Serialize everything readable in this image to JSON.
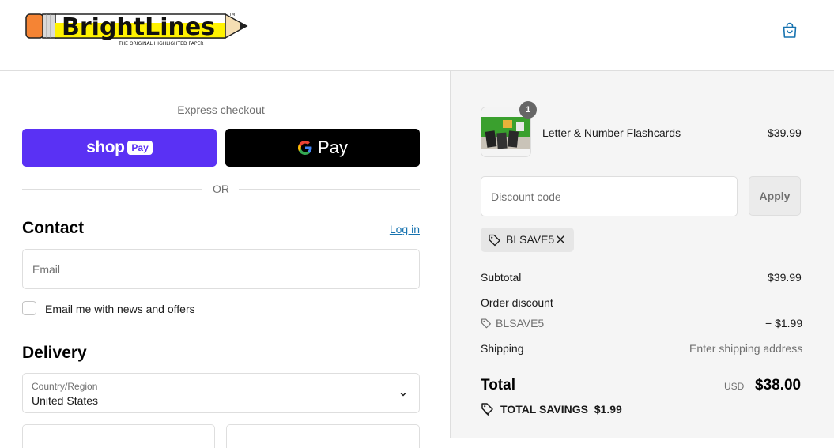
{
  "brand": {
    "logo_text": "BrightLines",
    "tagline": "THE ORIGINAL HIGHLIGHTED PAPER",
    "tm": "TM",
    "accent_color": "#1773b0"
  },
  "header": {
    "cart_icon": "shopping-bag-icon"
  },
  "express": {
    "title": "Express checkout",
    "shop_pay_word": "shop",
    "shop_pay_badge": "Pay",
    "shop_pay_color": "#5a31f4",
    "gpay_word": "Pay",
    "or_text": "OR"
  },
  "contact": {
    "title": "Contact",
    "login_link": "Log in",
    "email_placeholder": "Email",
    "newsletter_label": "Email me with news and offers",
    "newsletter_checked": false
  },
  "delivery": {
    "title": "Delivery",
    "country_label": "Country/Region",
    "country_value": "United States"
  },
  "summary": {
    "item": {
      "quantity": "1",
      "name": "Letter & Number Flashcards",
      "price": "$39.99"
    },
    "discount_placeholder": "Discount code",
    "apply_label": "Apply",
    "applied_code": "BLSAVE5",
    "subtotal_label": "Subtotal",
    "subtotal_value": "$39.99",
    "order_discount_label": "Order discount",
    "discount_code": "BLSAVE5",
    "discount_value": "− $1.99",
    "shipping_label": "Shipping",
    "shipping_value": "Enter shipping address",
    "total_label": "Total",
    "currency": "USD",
    "total_value": "$38.00",
    "savings_label": "TOTAL SAVINGS",
    "savings_value": "$1.99"
  }
}
